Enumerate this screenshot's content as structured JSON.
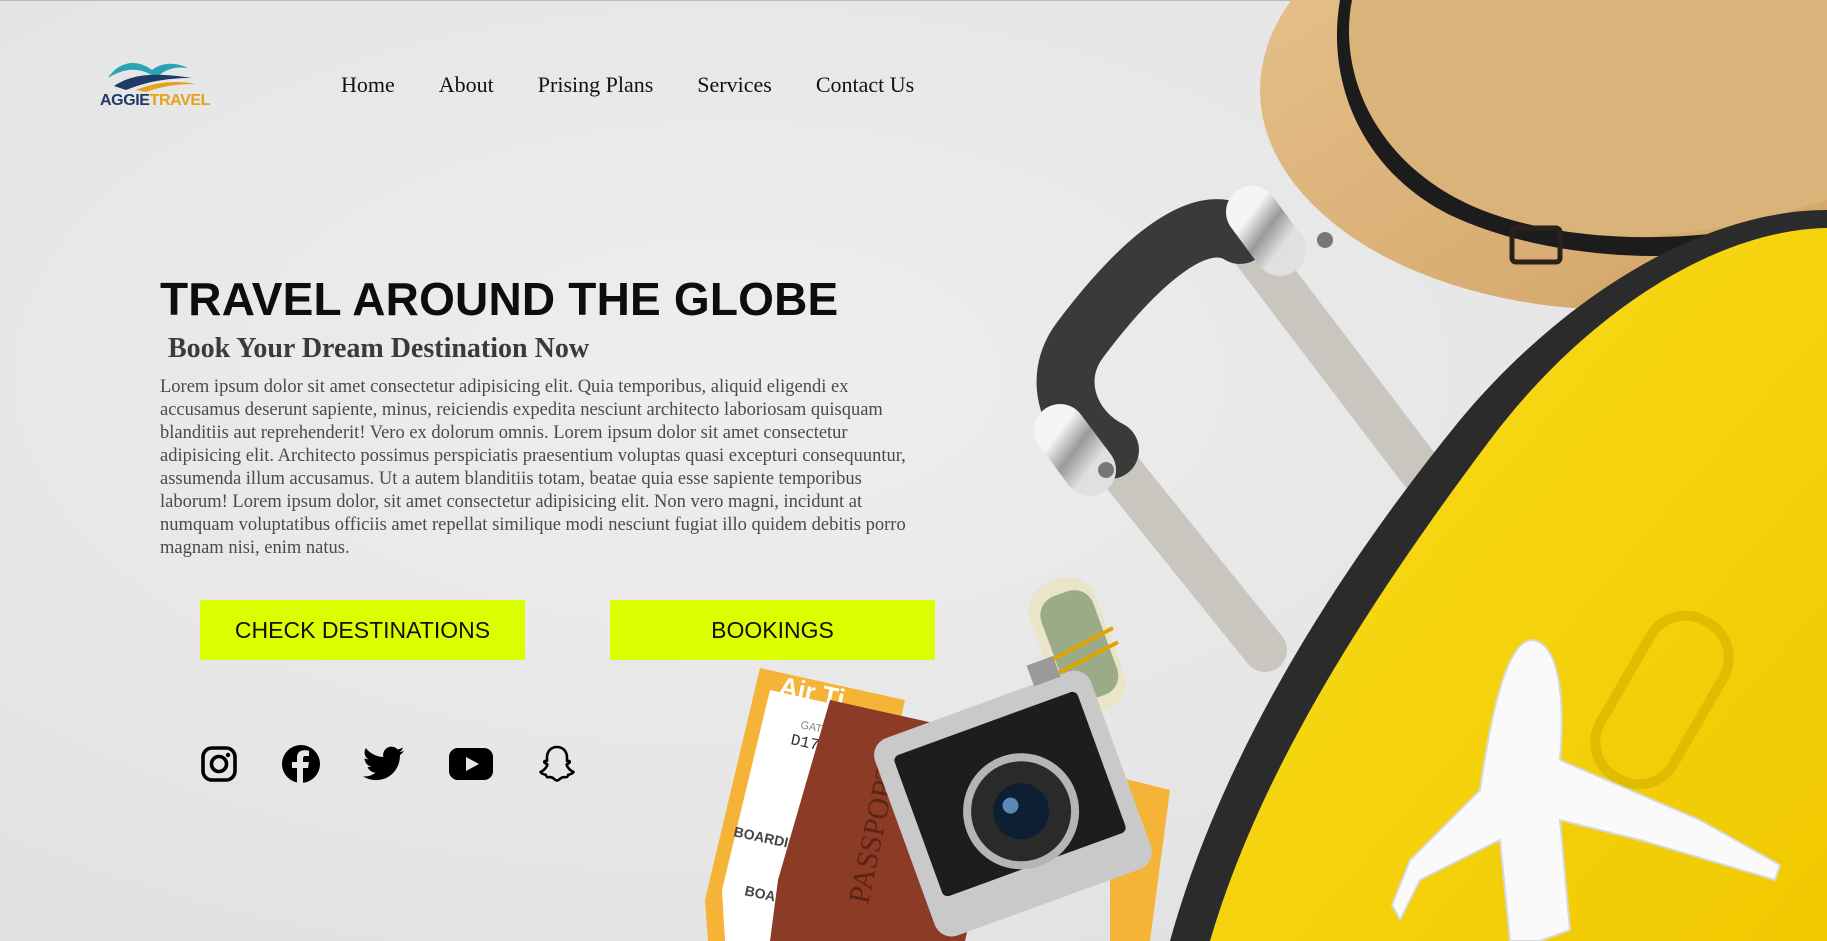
{
  "brand": {
    "logo_part1": "AGGIE",
    "logo_part2": "TRAVEL"
  },
  "nav": {
    "items": [
      {
        "label": "Home"
      },
      {
        "label": "About"
      },
      {
        "label": "Prising Plans"
      },
      {
        "label": "Services"
      },
      {
        "label": "Contact Us"
      }
    ]
  },
  "hero": {
    "title": "TRAVEL AROUND THE GLOBE",
    "subtitle": "Book Your Dream Destination Now",
    "body": "Lorem ipsum dolor sit amet consectetur adipisicing elit. Quia temporibus, aliquid eligendi ex accusamus deserunt sapiente, minus, reiciendis expedita nesciunt architecto laboriosam quisquam blanditiis aut reprehenderit! Vero ex dolorum omnis. Lorem ipsum dolor sit amet consectetur adipisicing elit. Architecto possimus perspiciatis praesentium voluptas quasi excepturi consequuntur, assumenda illum accusamus. Ut a autem blanditiis totam, beatae quia esse sapiente temporibus laborum! Lorem ipsum dolor, sit amet consectetur adipisicing elit. Non vero magni, incidunt at numquam voluptatibus officiis amet repellat similique modi nesciunt fugiat illo quidem debitis porro magnam nisi, enim natus."
  },
  "buttons": {
    "check_destinations": "CHECK DESTINATIONS",
    "bookings": "BOOKINGS"
  },
  "social": [
    "instagram-icon",
    "facebook-icon",
    "twitter-icon",
    "youtube-icon",
    "snapchat-icon"
  ],
  "illustration": {
    "ticket_heading": "Air Ti",
    "ticket_gate": "GATE",
    "ticket_gate_value": "D17",
    "ticket_boarding": "BOARDING",
    "ticket_boarding_2": "BOAR",
    "passport": "PASSPORT"
  },
  "colors": {
    "button_bg": "#dcff00",
    "suitcase": "#f7d708",
    "logo_navy": "#1e3a66",
    "logo_gold": "#e5a21b",
    "logo_teal": "#2aa3b3"
  }
}
